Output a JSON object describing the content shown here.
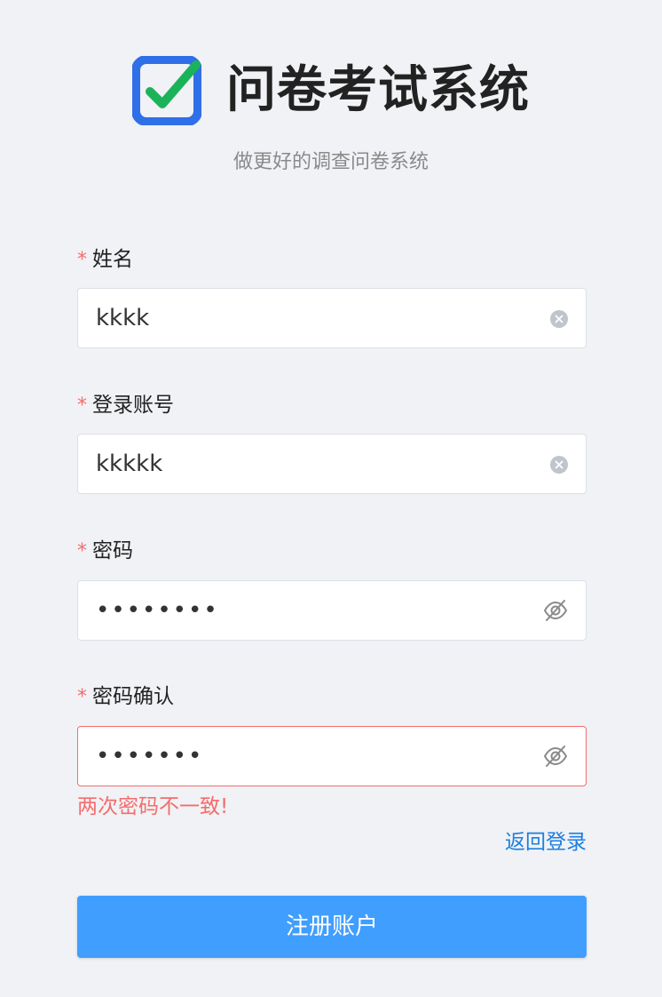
{
  "header": {
    "app_title": "问卷考试系统",
    "subtitle": "做更好的调查问卷系统",
    "logo_icon": "checkbox-check-icon"
  },
  "colors": {
    "brand_blue": "#2f6fe8",
    "check_green": "#1bb35a",
    "button_blue": "#409eff",
    "error_red": "#f56c6c",
    "link_blue": "#1e7fe0"
  },
  "form": {
    "required_mark": "*",
    "name": {
      "label": "姓名",
      "value": "kkkk",
      "icon": "clear-icon"
    },
    "account": {
      "label": "登录账号",
      "value": "kkkkk",
      "icon": "clear-icon"
    },
    "password": {
      "label": "密码",
      "value_masked": "••••••••",
      "icon": "eye-hidden-icon"
    },
    "confirm_password": {
      "label": "密码确认",
      "value_masked": "•••••••",
      "icon": "eye-hidden-icon",
      "error": "两次密码不一致!"
    },
    "back_link": "返回登录",
    "submit_label": "注册账户"
  }
}
